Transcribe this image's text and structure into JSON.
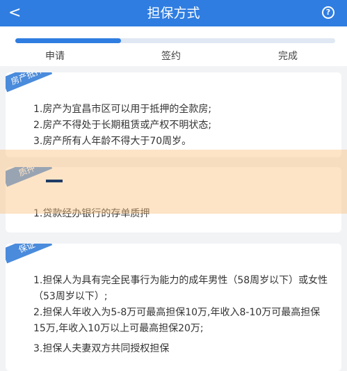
{
  "header": {
    "back_icon": "chevron-left-icon",
    "back_glyph": "<",
    "title": "担保方式",
    "help_icon": "question-circle-icon",
    "help_glyph": "?"
  },
  "steps": {
    "progress_fraction": 0.33,
    "labels": [
      "申请",
      "签约",
      "完成"
    ]
  },
  "cards": [
    {
      "tag": "房产抵押",
      "items": [
        "1.房产为宜昌市区可以用于抵押的全款房;",
        "2.房产不得处于长期租赁或产权不明状态;",
        "3.房产所有人年龄不得大于70周岁。"
      ]
    },
    {
      "tag": "质押",
      "items": [
        "1.贷款经办银行的存单质押"
      ]
    },
    {
      "tag": "保证",
      "items": [
        "1.担保人为具有完全民事行为能力的成年男性（58周岁以下）或女性（53周岁以下）;",
        "2.担保人年收入为5-8万可最高担保10万,年收入8-10万可最高担保15万,年收入10万以上可最高担保20万;",
        "3.担保人夫妻双方共同授权担保"
      ]
    }
  ],
  "colors": {
    "primary": "#2f7de1",
    "ribbon": "#4a8bdc",
    "overlay": "#fac480"
  }
}
